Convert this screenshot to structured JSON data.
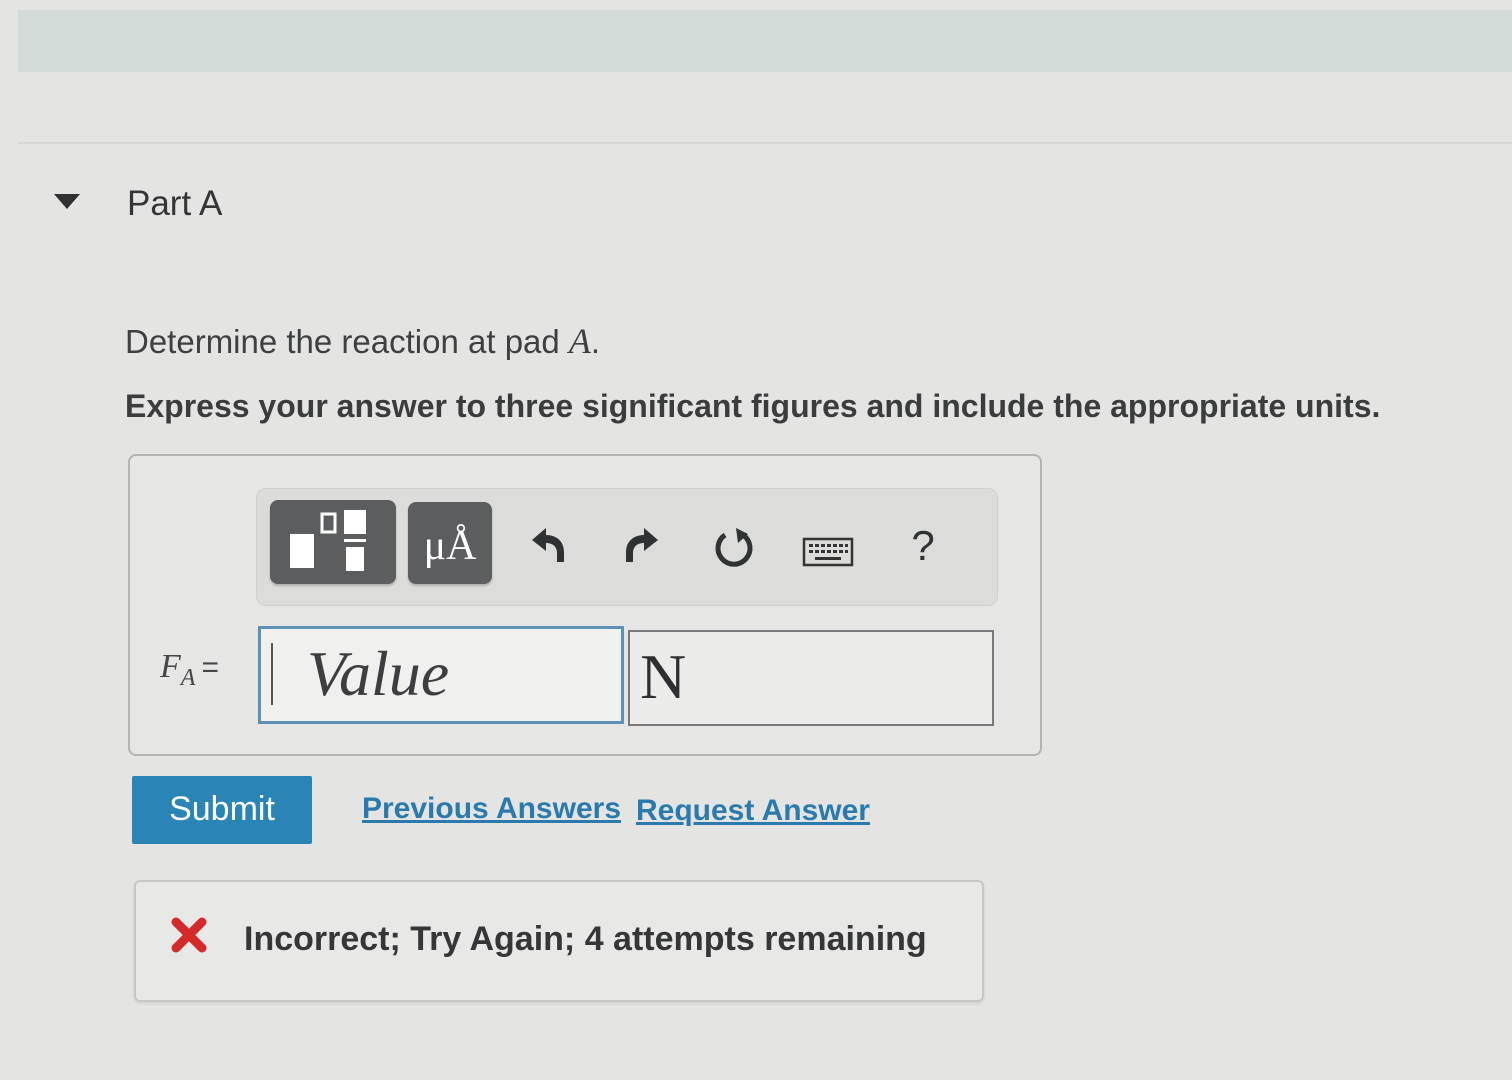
{
  "part": {
    "title": "Part A"
  },
  "question": {
    "text": "Determine the reaction at pad ",
    "variable": "A",
    "trailing": ".",
    "instruction": "Express your answer to three significant figures and include the appropriate units."
  },
  "toolbar": {
    "templates_icon": "templates-icon",
    "units_label": "μÅ",
    "undo_icon": "undo-icon",
    "redo_icon": "redo-icon",
    "reset_icon": "reset-icon",
    "keyboard_icon": "keyboard-icon",
    "help_label": "?"
  },
  "answer": {
    "variable": "F",
    "subscript": "A",
    "equals": "=",
    "value_placeholder": "Value",
    "unit": "N"
  },
  "actions": {
    "submit_label": "Submit",
    "previous_answers_label": "Previous Answers",
    "request_answer_label": "Request Answer"
  },
  "feedback": {
    "icon": "x-icon",
    "message": "Incorrect; Try Again; 4 attempts remaining",
    "color": "#d42a2a"
  },
  "colors": {
    "submit_bg": "#2a84b5",
    "link": "#2a7aae",
    "input_focus_border": "#5e8fb6"
  }
}
